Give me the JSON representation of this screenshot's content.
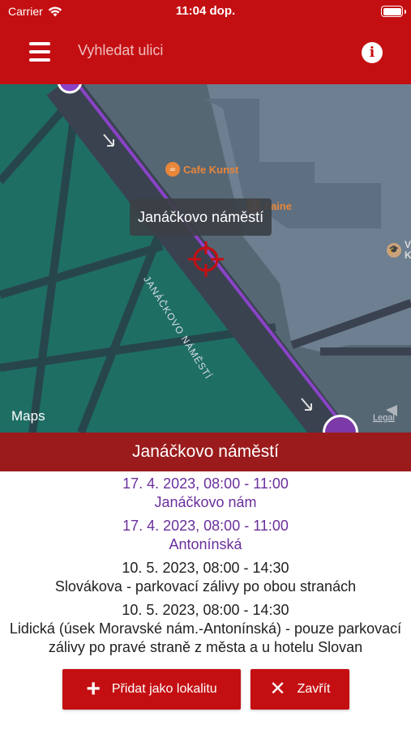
{
  "status_bar": {
    "carrier": "Carrier",
    "time": "11:04 dop."
  },
  "nav": {
    "search_placeholder": "Vyhledat ulici",
    "info_label": "i"
  },
  "map": {
    "tooltip": "Janáčkovo náměstí",
    "street_label": "JANÁČKOVO NÁMĚSTÍ",
    "pois": {
      "cafe": "Cafe Kunst",
      "faine": "Faine",
      "partial": "V\nK"
    },
    "logo_text": "Maps",
    "legal": "Legal",
    "colors": {
      "park": "#1e6e64",
      "road": "#3a4250",
      "building": "#6d7f90",
      "route": "#8a43c7"
    }
  },
  "detail": {
    "title": "Janáčkovo náměstí",
    "events": [
      {
        "date": "17. 4. 2023, 08:00 - 11:00",
        "place": "Janáčkovo nám",
        "highlight": true
      },
      {
        "date": "17. 4. 2023, 08:00 - 11:00",
        "place": "Antonínská",
        "highlight": true
      },
      {
        "date": "10. 5. 2023, 08:00 - 14:30",
        "place": "Slovákova - parkovací zálivy po obou stranách",
        "highlight": false
      },
      {
        "date": "10. 5. 2023, 08:00 - 14:30",
        "place": "Lidická (úsek Moravské nám.-Antonínská) - pouze parkovací zálivy po pravé straně z města a u hotelu Slovan",
        "highlight": false
      }
    ]
  },
  "buttons": {
    "add_label": "Přidat jako lokalitu",
    "close_label": "Zavřít"
  }
}
